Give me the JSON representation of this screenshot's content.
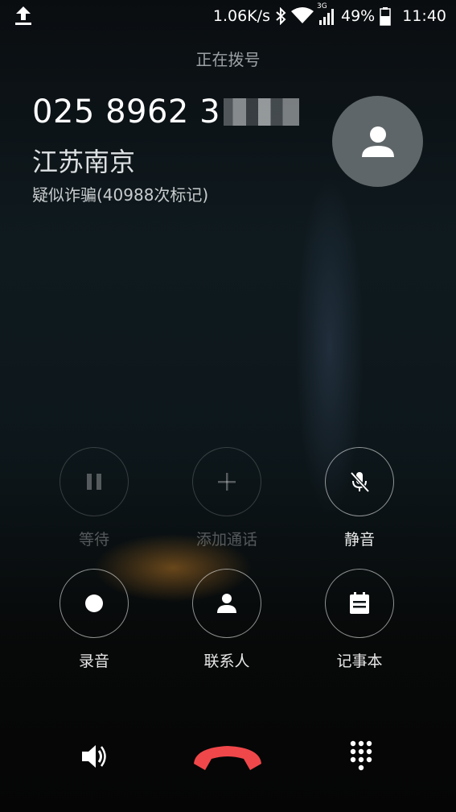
{
  "status_bar": {
    "net_speed": "1.06K/s",
    "network_type": "3G",
    "battery": "49%",
    "time": "11:40",
    "icons": [
      "upload-icon",
      "bluetooth-icon",
      "wifi-icon",
      "signal-icon",
      "battery-icon"
    ]
  },
  "call": {
    "state": "正在拨号",
    "number": "025 8962 3",
    "location": "江苏南京",
    "tag": "疑似诈骗(40988次标记)"
  },
  "controls": {
    "hold": "等待",
    "add_call": "添加通话",
    "mute": "静音",
    "record": "录音",
    "contacts": "联系人",
    "notes": "记事本"
  },
  "bottom_bar": {
    "speaker_icon": "speaker-icon",
    "end_call_icon": "end-call-icon",
    "dialpad_icon": "dialpad-icon",
    "end_call_color": "#f0474a"
  }
}
